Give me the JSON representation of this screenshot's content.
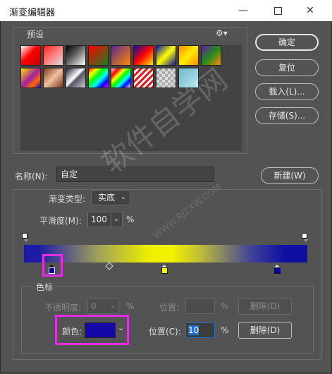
{
  "window": {
    "title": "渐变编辑器",
    "minimize_icon": "minimize-icon",
    "maximize_icon": "maximize-icon",
    "close_icon": "close-icon"
  },
  "presets": {
    "label": "预设",
    "gear_icon": "gear-icon",
    "swatches": [
      "red-gradient",
      "red-transparent",
      "black-white",
      "red-green",
      "violet-orange",
      "blue-red-yellow",
      "blue-yellow-blue",
      "orange-yellow-orange",
      "violet-green-orange",
      "yellow-violet-orange-blue",
      "copper",
      "chrome",
      "spectrum",
      "transparent-rainbow",
      "transparent-stripes",
      "transparent-checker",
      "cyan-pastel"
    ]
  },
  "buttons": {
    "ok": "确定",
    "reset": "复位",
    "load": "载入(L)...",
    "save": "存储(S)...",
    "new": "新建(W)"
  },
  "name": {
    "label": "名称(N):",
    "value": "自定"
  },
  "gradient": {
    "type_label": "渐变类型:",
    "type_value": "实底",
    "smoothness_label": "平滑度(M):",
    "smoothness_value": "100",
    "smoothness_unit": "%",
    "colors": {
      "stop1": "#0000a0",
      "stop2": "#ffff00",
      "stop3": "#0000a0"
    }
  },
  "stops": {
    "label": "色标",
    "opacity_label": "不透明度:",
    "opacity_value": "0",
    "opacity_unit": "%",
    "opacity_location_label": "位置:",
    "opacity_location_unit": "%",
    "opacity_delete": "删除(D)",
    "color_label": "颜色:",
    "color_value": "#1408a8",
    "color_location_label": "位置(C):",
    "color_location_value": "10",
    "color_location_unit": "%",
    "color_delete": "删除(D)"
  },
  "watermark": {
    "text": "软件自学网",
    "url": "WWW.RJZXW.COM"
  }
}
